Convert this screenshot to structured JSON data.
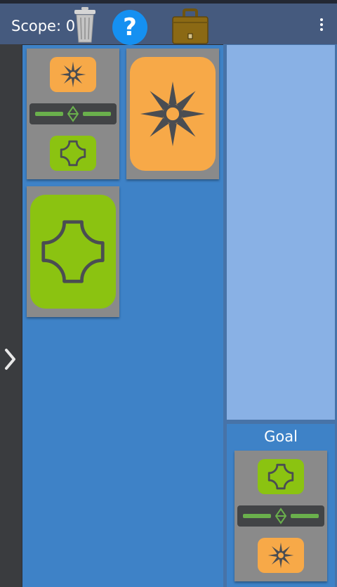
{
  "app": {
    "scope_label": "Scope: 0",
    "help_label": "?"
  },
  "icons": {
    "trash": "trash-can-icon",
    "help": "help-icon",
    "briefcase": "briefcase-icon",
    "menu": "more-vertical-icon",
    "drawer": "chevron-right-icon",
    "sun": "sun-burst-icon",
    "star": "four-point-star-icon",
    "link": "diamond-link-icon"
  },
  "colors": {
    "topbar": "#455a7e",
    "board": "#3e82c7",
    "inventory": "#89b1e5",
    "card": "#8a8a8a",
    "orange_tile": "#f7a948",
    "green_tile": "#8bc311",
    "connector": "#424446",
    "connector_line": "#6ab04c"
  },
  "goal": {
    "label": "Goal"
  }
}
